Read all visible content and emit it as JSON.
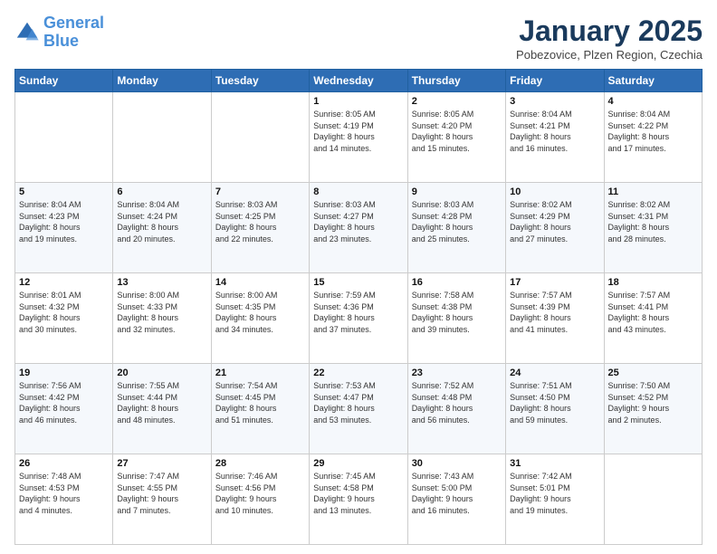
{
  "header": {
    "logo_line1": "General",
    "logo_line2": "Blue",
    "month_title": "January 2025",
    "location": "Pobezovice, Plzen Region, Czechia"
  },
  "days_of_week": [
    "Sunday",
    "Monday",
    "Tuesday",
    "Wednesday",
    "Thursday",
    "Friday",
    "Saturday"
  ],
  "weeks": [
    [
      {
        "day": "",
        "info": ""
      },
      {
        "day": "",
        "info": ""
      },
      {
        "day": "",
        "info": ""
      },
      {
        "day": "1",
        "info": "Sunrise: 8:05 AM\nSunset: 4:19 PM\nDaylight: 8 hours\nand 14 minutes."
      },
      {
        "day": "2",
        "info": "Sunrise: 8:05 AM\nSunset: 4:20 PM\nDaylight: 8 hours\nand 15 minutes."
      },
      {
        "day": "3",
        "info": "Sunrise: 8:04 AM\nSunset: 4:21 PM\nDaylight: 8 hours\nand 16 minutes."
      },
      {
        "day": "4",
        "info": "Sunrise: 8:04 AM\nSunset: 4:22 PM\nDaylight: 8 hours\nand 17 minutes."
      }
    ],
    [
      {
        "day": "5",
        "info": "Sunrise: 8:04 AM\nSunset: 4:23 PM\nDaylight: 8 hours\nand 19 minutes."
      },
      {
        "day": "6",
        "info": "Sunrise: 8:04 AM\nSunset: 4:24 PM\nDaylight: 8 hours\nand 20 minutes."
      },
      {
        "day": "7",
        "info": "Sunrise: 8:03 AM\nSunset: 4:25 PM\nDaylight: 8 hours\nand 22 minutes."
      },
      {
        "day": "8",
        "info": "Sunrise: 8:03 AM\nSunset: 4:27 PM\nDaylight: 8 hours\nand 23 minutes."
      },
      {
        "day": "9",
        "info": "Sunrise: 8:03 AM\nSunset: 4:28 PM\nDaylight: 8 hours\nand 25 minutes."
      },
      {
        "day": "10",
        "info": "Sunrise: 8:02 AM\nSunset: 4:29 PM\nDaylight: 8 hours\nand 27 minutes."
      },
      {
        "day": "11",
        "info": "Sunrise: 8:02 AM\nSunset: 4:31 PM\nDaylight: 8 hours\nand 28 minutes."
      }
    ],
    [
      {
        "day": "12",
        "info": "Sunrise: 8:01 AM\nSunset: 4:32 PM\nDaylight: 8 hours\nand 30 minutes."
      },
      {
        "day": "13",
        "info": "Sunrise: 8:00 AM\nSunset: 4:33 PM\nDaylight: 8 hours\nand 32 minutes."
      },
      {
        "day": "14",
        "info": "Sunrise: 8:00 AM\nSunset: 4:35 PM\nDaylight: 8 hours\nand 34 minutes."
      },
      {
        "day": "15",
        "info": "Sunrise: 7:59 AM\nSunset: 4:36 PM\nDaylight: 8 hours\nand 37 minutes."
      },
      {
        "day": "16",
        "info": "Sunrise: 7:58 AM\nSunset: 4:38 PM\nDaylight: 8 hours\nand 39 minutes."
      },
      {
        "day": "17",
        "info": "Sunrise: 7:57 AM\nSunset: 4:39 PM\nDaylight: 8 hours\nand 41 minutes."
      },
      {
        "day": "18",
        "info": "Sunrise: 7:57 AM\nSunset: 4:41 PM\nDaylight: 8 hours\nand 43 minutes."
      }
    ],
    [
      {
        "day": "19",
        "info": "Sunrise: 7:56 AM\nSunset: 4:42 PM\nDaylight: 8 hours\nand 46 minutes."
      },
      {
        "day": "20",
        "info": "Sunrise: 7:55 AM\nSunset: 4:44 PM\nDaylight: 8 hours\nand 48 minutes."
      },
      {
        "day": "21",
        "info": "Sunrise: 7:54 AM\nSunset: 4:45 PM\nDaylight: 8 hours\nand 51 minutes."
      },
      {
        "day": "22",
        "info": "Sunrise: 7:53 AM\nSunset: 4:47 PM\nDaylight: 8 hours\nand 53 minutes."
      },
      {
        "day": "23",
        "info": "Sunrise: 7:52 AM\nSunset: 4:48 PM\nDaylight: 8 hours\nand 56 minutes."
      },
      {
        "day": "24",
        "info": "Sunrise: 7:51 AM\nSunset: 4:50 PM\nDaylight: 8 hours\nand 59 minutes."
      },
      {
        "day": "25",
        "info": "Sunrise: 7:50 AM\nSunset: 4:52 PM\nDaylight: 9 hours\nand 2 minutes."
      }
    ],
    [
      {
        "day": "26",
        "info": "Sunrise: 7:48 AM\nSunset: 4:53 PM\nDaylight: 9 hours\nand 4 minutes."
      },
      {
        "day": "27",
        "info": "Sunrise: 7:47 AM\nSunset: 4:55 PM\nDaylight: 9 hours\nand 7 minutes."
      },
      {
        "day": "28",
        "info": "Sunrise: 7:46 AM\nSunset: 4:56 PM\nDaylight: 9 hours\nand 10 minutes."
      },
      {
        "day": "29",
        "info": "Sunrise: 7:45 AM\nSunset: 4:58 PM\nDaylight: 9 hours\nand 13 minutes."
      },
      {
        "day": "30",
        "info": "Sunrise: 7:43 AM\nSunset: 5:00 PM\nDaylight: 9 hours\nand 16 minutes."
      },
      {
        "day": "31",
        "info": "Sunrise: 7:42 AM\nSunset: 5:01 PM\nDaylight: 9 hours\nand 19 minutes."
      },
      {
        "day": "",
        "info": ""
      }
    ]
  ]
}
